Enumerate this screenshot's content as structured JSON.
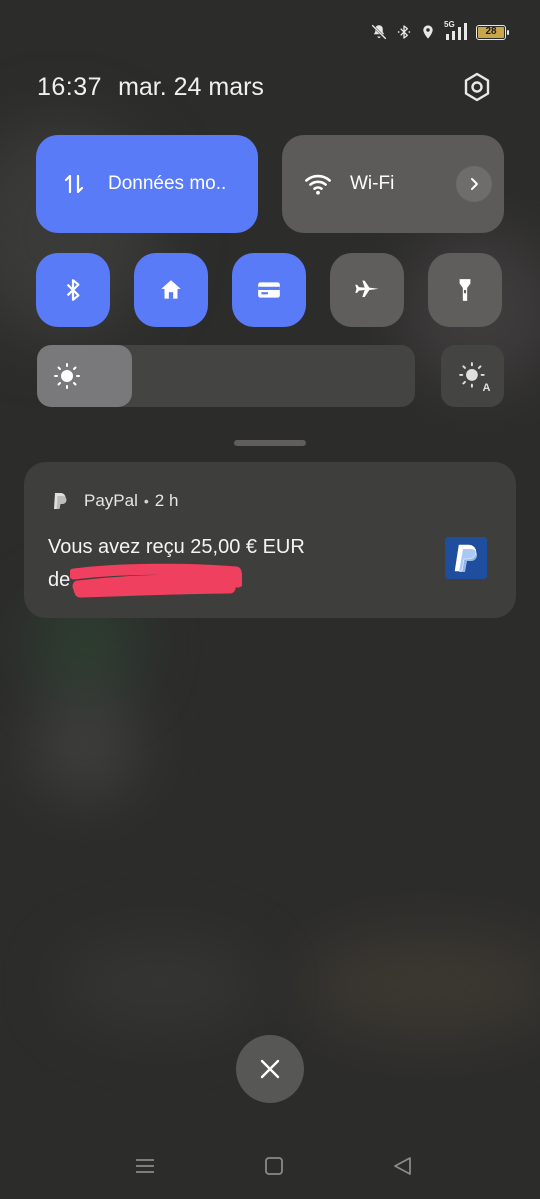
{
  "status_bar": {
    "network": "5G",
    "battery": "28",
    "icons": [
      "mute-icon",
      "bluetooth-icon",
      "location-icon",
      "signal-icon",
      "battery-icon"
    ]
  },
  "header": {
    "time": "16:37",
    "date": "mar. 24 mars"
  },
  "quick_settings": {
    "data_tile": {
      "label": "Données mo..",
      "icon": "data-arrows-icon",
      "active": true
    },
    "wifi_tile": {
      "label": "Wi-Fi",
      "icon": "wifi-icon",
      "active": false
    },
    "small_tiles": [
      {
        "icon": "bluetooth-icon",
        "active": true
      },
      {
        "icon": "home-icon",
        "active": true
      },
      {
        "icon": "card-icon",
        "active": true
      },
      {
        "icon": "airplane-icon",
        "active": false
      },
      {
        "icon": "flashlight-icon",
        "active": false
      }
    ],
    "brightness_level": 0.25,
    "auto_brightness_badge": "A"
  },
  "notification": {
    "app": "PayPal",
    "separator": "•",
    "time_ago": "2 h",
    "title": "Vous avez reçu 25,00 € EUR",
    "from_prefix": "de",
    "redaction_color": "#f0405f"
  },
  "colors": {
    "accent": "#5a7bf7",
    "tile_off": "#5f5e5c",
    "background": "#2c2c2b"
  }
}
